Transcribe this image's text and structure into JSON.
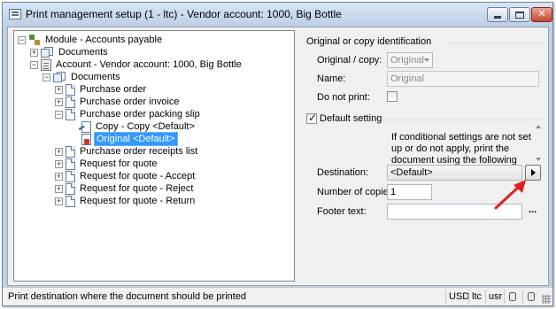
{
  "window": {
    "title": "Print management setup (1 - ltc) - Vendor account: 1000, Big Bottle"
  },
  "tree": {
    "module": "Module - Accounts payable",
    "documents_root": "Documents",
    "account": "Account - Vendor account: 1000, Big Bottle",
    "documents": "Documents",
    "items": [
      "Purchase order",
      "Purchase order invoice",
      "Purchase order packing slip",
      "Purchase order receipts list",
      "Request for quote",
      "Request for quote - Accept",
      "Request for quote - Reject",
      "Request for quote - Return"
    ],
    "copy_node": "Copy - Copy <Default>",
    "original_node": "Original <Default>"
  },
  "props": {
    "group_title": "Original or copy identification",
    "original_copy_label": "Original / copy:",
    "original_copy_value": "Original",
    "name_label": "Name:",
    "name_value": "Original",
    "do_not_print_label": "Do not print:",
    "default_setting_label": "Default setting",
    "info_text": "If conditional settings are not set up or do not apply, print the document using the following setting.",
    "destination_label": "Destination:",
    "destination_value": "<Default>",
    "copies_label": "Number of copies:",
    "copies_value": "1",
    "footer_label": "Footer text:",
    "footer_value": "",
    "footer_button": "..."
  },
  "status": {
    "text": "Print destination where the document should be printed",
    "currency": "USD",
    "company": "ltc",
    "user": "usr"
  },
  "colors": {
    "selection": "#3399ff",
    "annotation_arrow": "#e02020"
  }
}
